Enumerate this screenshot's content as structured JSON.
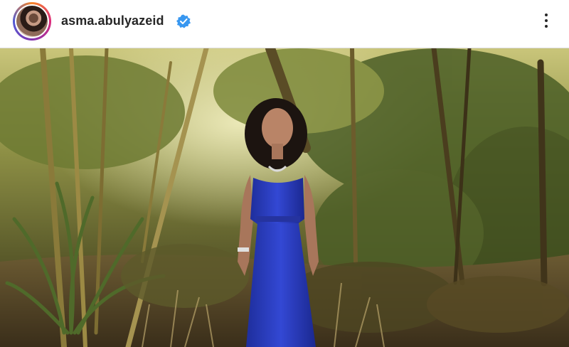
{
  "header": {
    "username": "asma.abulyazeid",
    "verified": true,
    "avatar_icon": "profile-photo-icon",
    "verified_icon": "verified-badge-icon",
    "more_icon": "more-options-icon"
  },
  "post": {
    "image_icon": "photo-content",
    "colors": {
      "dress": "#2b3fc4",
      "foliage": "#4f6a2a",
      "verified": "#3897f0"
    }
  }
}
